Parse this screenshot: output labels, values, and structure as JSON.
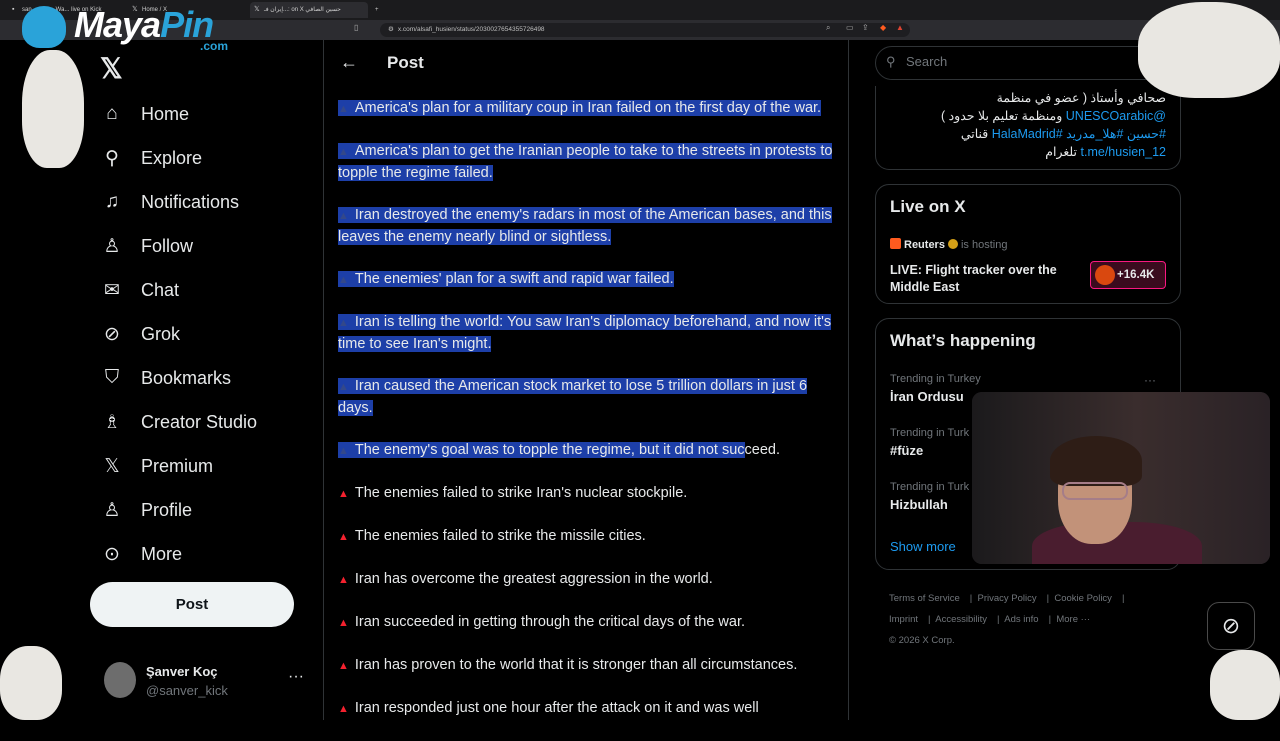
{
  "browser": {
    "tabs": [
      {
        "label": "san... clips - Wa... live on Kick"
      },
      {
        "label": "Home / X"
      },
      {
        "label": "إيران فـ...: on X حسين الصافي"
      }
    ],
    "url": "x.com/alsafi_husien/status/2030027654355726498"
  },
  "overlay": {
    "logo_main": "Maya",
    "logo_accent": "Pin",
    "logo_suffix": ".com"
  },
  "sidebar": {
    "items": [
      {
        "label": "Home",
        "icon": "home-icon"
      },
      {
        "label": "Explore",
        "icon": "search-icon"
      },
      {
        "label": "Notifications",
        "icon": "bell-icon"
      },
      {
        "label": "Follow",
        "icon": "person-add-icon"
      },
      {
        "label": "Chat",
        "icon": "mail-icon"
      },
      {
        "label": "Grok",
        "icon": "grok-icon"
      },
      {
        "label": "Bookmarks",
        "icon": "bookmark-icon"
      },
      {
        "label": "Creator Studio",
        "icon": "flask-icon"
      },
      {
        "label": "Premium",
        "icon": "x-icon"
      },
      {
        "label": "Profile",
        "icon": "person-icon"
      },
      {
        "label": "More",
        "icon": "more-circle-icon"
      }
    ],
    "post_label": "Post",
    "user": {
      "name": "Şanver Koç",
      "handle": "@sanver_kick"
    }
  },
  "main": {
    "title": "Post",
    "paragraphs": [
      {
        "text": "America's plan for a military coup in Iran failed on the first day of the war.",
        "selected": true
      },
      {
        "text": "America's plan to get the Iranian people to take to the streets in protests to topple the regime failed.",
        "selected": true
      },
      {
        "text": "Iran destroyed the enemy's radars in most of the American bases, and this leaves the enemy nearly blind or sightless.",
        "selected": true
      },
      {
        "text": "The enemies' plan for a swift and rapid war failed.",
        "selected": true
      },
      {
        "text": "Iran is telling the world: You saw Iran's diplomacy beforehand, and now it's time to see Iran's might.",
        "selected": true
      },
      {
        "text": "Iran caused the American stock market to lose 5 trillion dollars in just 6 days.",
        "selected": true
      },
      {
        "text_selected": "The enemy's goal was to topple the regime, but it did not suc",
        "text_rest": "ceed.",
        "partial": true
      },
      {
        "text": "The enemies failed to strike Iran's nuclear stockpile.",
        "selected": false
      },
      {
        "text": "The enemies failed to strike the missile cities.",
        "selected": false
      },
      {
        "text": "Iran has overcome the greatest aggression in the world.",
        "selected": false
      },
      {
        "text": "Iran succeeded in getting through the critical days of the war.",
        "selected": false
      },
      {
        "text": "Iran has proven to the world that it is stronger than all circumstances.",
        "selected": false
      },
      {
        "text": "Iran responded just one hour after the attack on it and was well",
        "selected": false
      }
    ]
  },
  "right": {
    "search_placeholder": "Search",
    "bio": {
      "line1": "صحافي وأستاذ ( عضو في منظمة",
      "line2_link": "@UNESCOarabic",
      "line2_text": " ومنظمة تعليم بلا حدود )",
      "line3_links": "#حسين #هلا_مدريد #HalaMadrid",
      "line3_text": " قناتي",
      "line4_link": "t.me/husien_12",
      "line4_text": " تلغرام"
    },
    "live": {
      "title": "Live on X",
      "host_name": "Reuters",
      "host_suffix": "is hosting",
      "description": "LIVE: Flight tracker over the Middle East",
      "listeners": "+16.4K"
    },
    "happening": {
      "title": "What’s happening",
      "trends": [
        {
          "meta": "Trending in Turkey",
          "name": "İran Ordusu"
        },
        {
          "meta": "Trending in Turk",
          "name": "#füze"
        },
        {
          "meta": "Trending in Turk",
          "name": "Hizbullah"
        }
      ],
      "show_more": "Show more"
    },
    "footer": {
      "links": [
        "Terms of Service",
        "Privacy Policy",
        "Cookie Policy",
        "Imprint",
        "Accessibility",
        "Ads info",
        "More ···"
      ],
      "copyright": "© 2026 X Corp."
    }
  }
}
